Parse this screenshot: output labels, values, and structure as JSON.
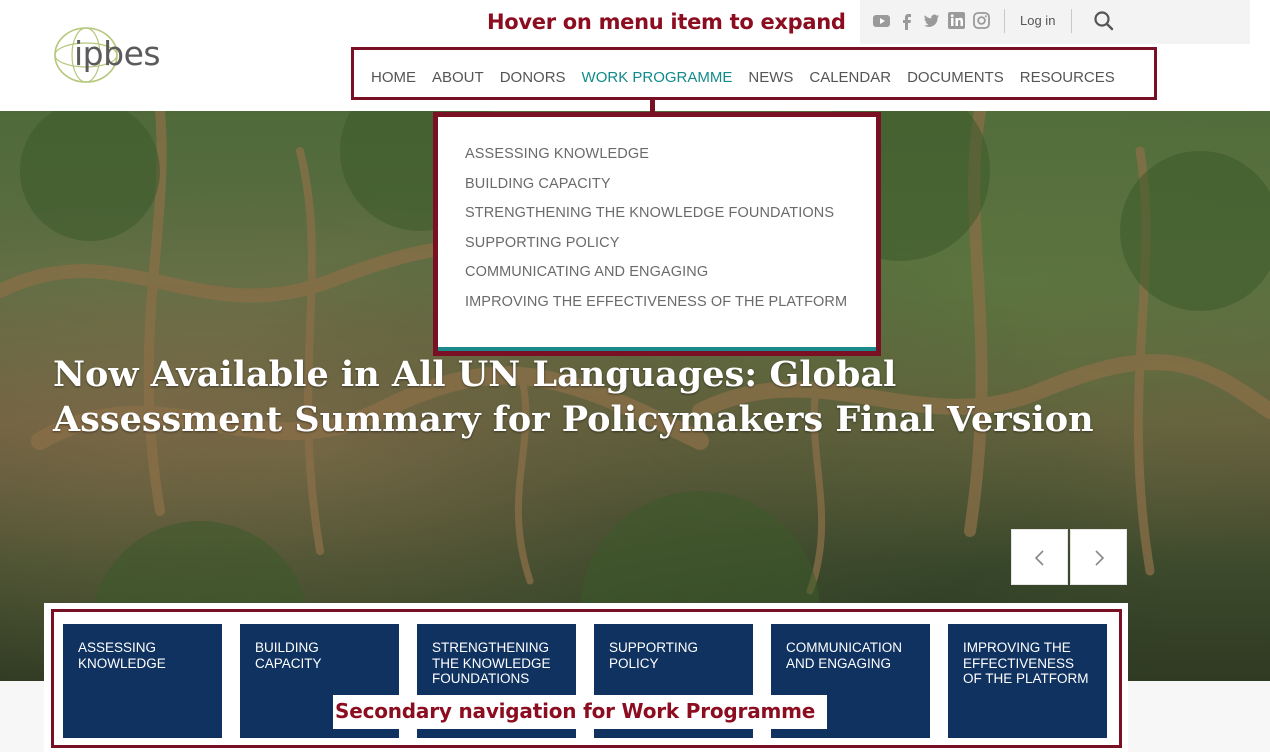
{
  "annotations": {
    "hover_note": "Hover on menu item to expand",
    "secondary_note": "Secondary navigation for Work Programme"
  },
  "brand": {
    "logo_text": "ipbes",
    "accent": "#7a1023",
    "teal": "#138a8a",
    "navy": "#0f3260"
  },
  "topbar": {
    "social_icons": [
      "youtube-icon",
      "facebook-icon",
      "twitter-icon",
      "linkedin-icon",
      "instagram-icon"
    ],
    "login_label": "Log in",
    "search_icon": "search-icon"
  },
  "main_nav": {
    "items": [
      "HOME",
      "ABOUT",
      "DONORS",
      "WORK PROGRAMME",
      "NEWS",
      "CALENDAR",
      "DOCUMENTS",
      "RESOURCES"
    ],
    "active": "WORK PROGRAMME"
  },
  "dropdown": {
    "items": [
      "ASSESSING KNOWLEDGE",
      "BUILDING CAPACITY",
      "STRENGTHENING THE KNOWLEDGE FOUNDATIONS",
      "SUPPORTING POLICY",
      "COMMUNICATING AND ENGAGING",
      "IMPROVING THE EFFECTIVENESS OF THE PLATFORM"
    ]
  },
  "hero": {
    "headline": "Now Available in All UN Languages: Global Assessment Summary for Policymakers Final Version",
    "prev_icon": "chevron-left-icon",
    "next_icon": "chevron-right-icon"
  },
  "secondary_nav": {
    "tiles": [
      "ASSESSING KNOWLEDGE",
      "BUILDING CAPACITY",
      "STRENGTHENING THE KNOWLEDGE FOUNDATIONS",
      "SUPPORTING POLICY",
      "COMMUNICATION AND ENGAGING",
      "IMPROVING THE EFFECTIVENESS OF THE PLATFORM"
    ]
  }
}
